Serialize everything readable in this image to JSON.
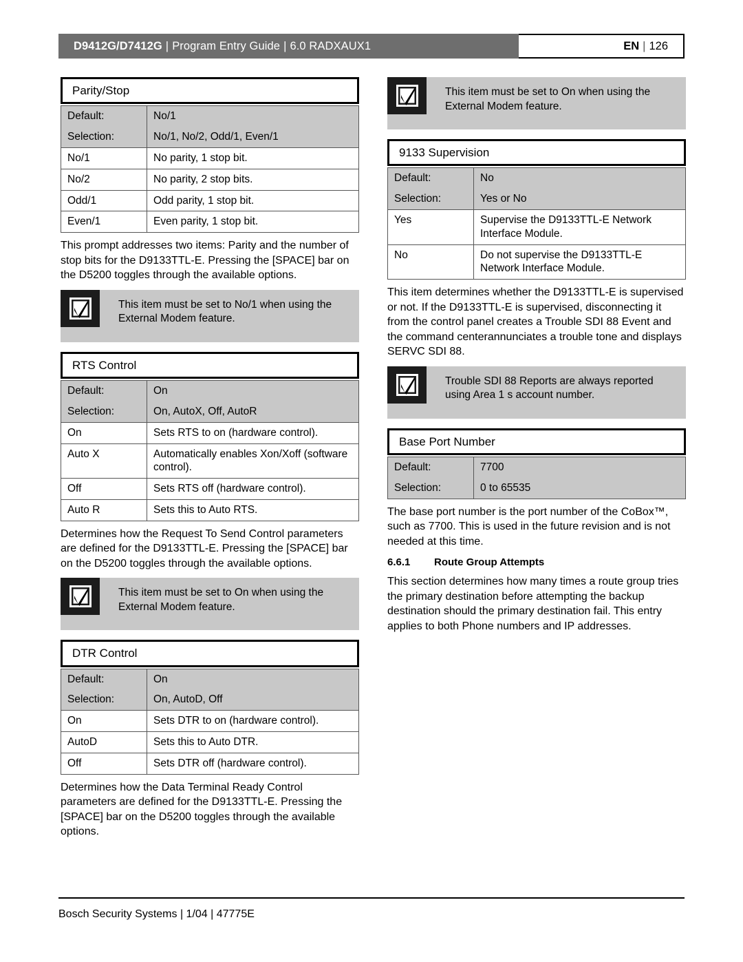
{
  "header": {
    "doc_model": "D9412G/D7412G",
    "separator": "|",
    "guide": "Program Entry Guide",
    "section": "6.0  RADXAUX1",
    "lang": "EN",
    "page_number": "126"
  },
  "footer": {
    "text": "Bosch Security Systems | 1/04 | 47775E"
  },
  "left_column": {
    "parity_stop": {
      "title": "Parity/Stop",
      "default_label": "Default:",
      "default_value": "No/1",
      "selection_label": "Selection:",
      "selection_value": "No/1, No/2, Odd/1, Even/1",
      "rows": [
        {
          "key": "No/1",
          "desc": "No parity, 1 stop bit."
        },
        {
          "key": "No/2",
          "desc": "No parity, 2 stop bits."
        },
        {
          "key": "Odd/1",
          "desc": "Odd parity, 1 stop bit."
        },
        {
          "key": "Even/1",
          "desc": "Even parity, 1 stop bit."
        }
      ],
      "body": "This prompt addresses two items: Parity and the number of stop bits for the D9133TTL-E. Pressing the [SPACE] bar on the D5200 toggles through the available options.",
      "note": "This item must be set to No/1 when using the External Modem feature."
    },
    "rts_control": {
      "title": "RTS Control",
      "default_label": "Default:",
      "default_value": "On",
      "selection_label": "Selection:",
      "selection_value": "On, AutoX, Off, AutoR",
      "rows": [
        {
          "key": "On",
          "desc": "Sets RTS to on (hardware control)."
        },
        {
          "key": "Auto X",
          "desc": "Automatically enables Xon/Xoff (software control)."
        },
        {
          "key": "Off",
          "desc": "Sets RTS off (hardware control)."
        },
        {
          "key": "Auto R",
          "desc": "Sets this to Auto RTS."
        }
      ],
      "body": "Determines how the Request To Send Control parameters are defined for the D9133TTL-E. Pressing the [SPACE] bar on the D5200 toggles through the available options.",
      "note": "This item must be set to On when using the External Modem feature."
    },
    "dtr_control": {
      "title": "DTR Control",
      "default_label": "Default:",
      "default_value": "On",
      "selection_label": "Selection:",
      "selection_value": "On, AutoD, Off",
      "rows": [
        {
          "key": "On",
          "desc": "Sets DTR to on (hardware control)."
        },
        {
          "key": "AutoD",
          "desc": "Sets this to Auto DTR."
        },
        {
          "key": "Off",
          "desc": "Sets DTR off (hardware control)."
        }
      ],
      "body": "Determines how the Data Terminal Ready Control parameters are defined for the D9133TTL-E. Pressing the [SPACE] bar on the D5200 toggles through the available options."
    }
  },
  "right_column": {
    "top_note": "This item must be set to On when using the External Modem feature.",
    "supervision_9133": {
      "title": "9133 Supervision",
      "default_label": "Default:",
      "default_value": "No",
      "selection_label": "Selection:",
      "selection_value": "Yes or No",
      "rows": [
        {
          "key": "Yes",
          "desc": "Supervise the D9133TTL-E Network Interface Module."
        },
        {
          "key": "No",
          "desc": "Do not supervise the D9133TTL-E Network Interface Module."
        }
      ],
      "body": "This item determines whether the D9133TTL-E is supervised or not. If the D9133TTL-E is supervised, disconnecting it from the control panel creates a Trouble SDI 88 Event and the command centerannunciates a trouble tone and displays SERVC SDI 88.",
      "note": "Trouble SDI 88 Reports are always reported using Area 1 s account number."
    },
    "base_port_number": {
      "title": "Base Port Number",
      "default_label": "Default:",
      "default_value": "7700",
      "selection_label": "Selection:",
      "selection_value": "0 to 65535",
      "body": "The base port number is the port number of the CoBox™, such as 7700. This is used in the future revision and is not needed at this time."
    },
    "route_group_attempts": {
      "number": "6.6.1",
      "title": "Route Group Attempts",
      "body": "This section determines how many times a route group tries the primary destination before attempting the backup destination should the primary destination fail. This entry applies to both Phone numbers and IP addresses."
    }
  },
  "icons": {
    "note_icon": "checkmark-box-icon"
  },
  "colors": {
    "header_bar": "#6e6e6e",
    "table_header_fill": "#c8c8c8",
    "note_fill": "#c8c8c8",
    "note_icon_fill": "#1c1c1c",
    "text": "#000000"
  }
}
